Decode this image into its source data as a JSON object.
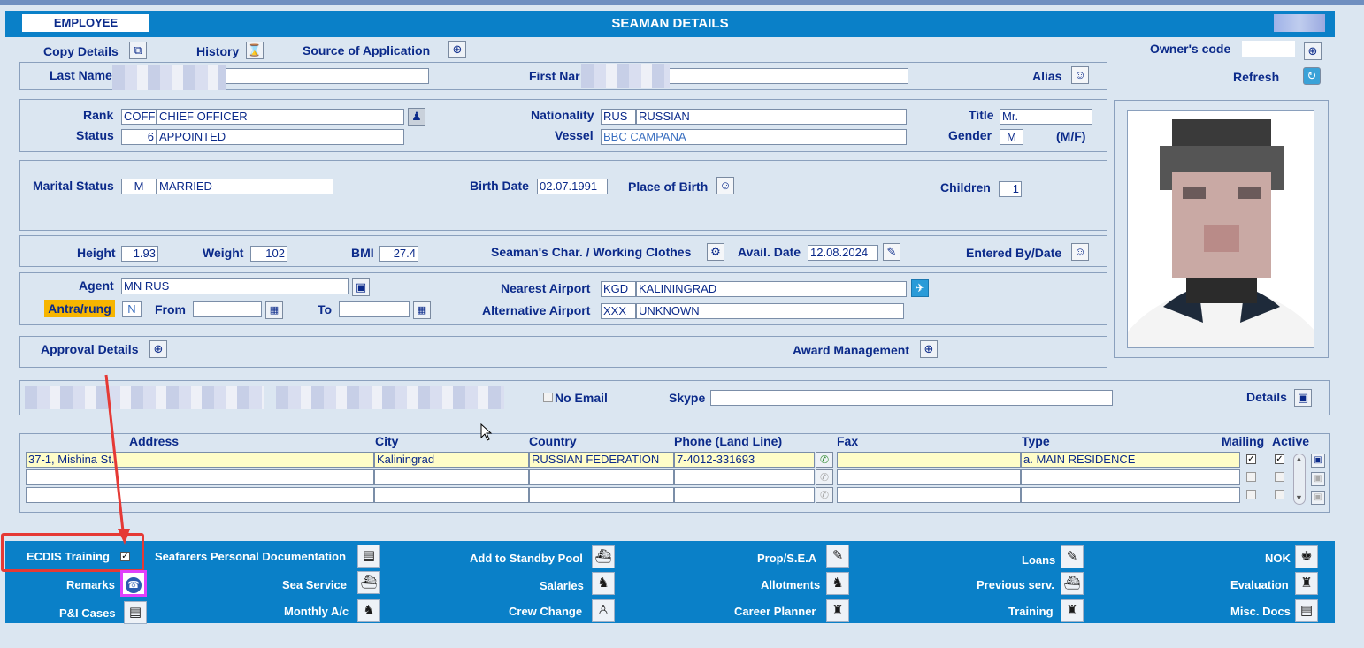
{
  "window": {
    "title": "SEAMAN DETAILS",
    "employee_tab": "EMPLOYEE"
  },
  "toolbar": {
    "copy_details": "Copy Details",
    "history": "History",
    "source_of_application": "Source of Application",
    "owners_code": "Owner's code",
    "owners_code_value": "",
    "refresh": "Refresh"
  },
  "names": {
    "last_name_label": "Last Name",
    "first_name_label": "First Nar",
    "alias_label": "Alias"
  },
  "rank_section": {
    "rank_label": "Rank",
    "rank_code": "COFF",
    "rank_name": "CHIEF OFFICER",
    "status_label": "Status",
    "status_code": "6",
    "status_name": "APPOINTED",
    "nationality_label": "Nationality",
    "nationality_code": "RUS",
    "nationality_name": "RUSSIAN",
    "vessel_label": "Vessel",
    "vessel_name": "BBC CAMPANA",
    "title_label": "Title",
    "title_value": "Mr.",
    "gender_label": "Gender",
    "gender_value": "M",
    "gender_hint": "(M/F)"
  },
  "personal": {
    "marital_label": "Marital Status",
    "marital_code": "M",
    "marital_name": "MARRIED",
    "birth_date_label": "Birth Date",
    "birth_date": "02.07.1991",
    "place_of_birth_label": "Place of Birth",
    "children_label": "Children",
    "children": "1"
  },
  "body": {
    "height_label": "Height",
    "height": "1.93",
    "weight_label": "Weight",
    "weight": "102",
    "bmi_label": "BMI",
    "bmi": "27.4",
    "char_label": "Seaman's Char. / Working Clothes",
    "avail_label": "Avail. Date",
    "avail_date": "12.08.2024",
    "entered_label": "Entered By/Date"
  },
  "agent": {
    "agent_label": "Agent",
    "agent_value": "MN RUS",
    "antra_label": "Antra/rung",
    "antra_value": "N",
    "from_label": "From",
    "to_label": "To",
    "nearest_label": "Nearest Airport",
    "nearest_code": "KGD",
    "nearest_name": "KALININGRAD",
    "alt_label": "Alternative Airport",
    "alt_code": "XXX",
    "alt_name": "UNKNOWN"
  },
  "approval": {
    "approval_label": "Approval Details",
    "award_label": "Award Management"
  },
  "contact": {
    "no_email_label": "No Email",
    "skype_label": "Skype",
    "details_label": "Details"
  },
  "address_table": {
    "headers": [
      "Address",
      "City",
      "Country",
      "Phone (Land Line)",
      "Fax",
      "Type",
      "Mailing",
      "Active"
    ],
    "rows": [
      {
        "address": "37-1, Mishina St.",
        "city": "Kaliningrad",
        "country": "RUSSIAN FEDERATION",
        "phone": "7-4012-331693",
        "fax": "",
        "type": "a. MAIN RESIDENCE",
        "mailing": "✓",
        "active": "✓"
      },
      {
        "address": "",
        "city": "",
        "country": "",
        "phone": "",
        "fax": "",
        "type": "",
        "mailing": "",
        "active": ""
      },
      {
        "address": "",
        "city": "",
        "country": "",
        "phone": "",
        "fax": "",
        "type": "",
        "mailing": "",
        "active": ""
      }
    ]
  },
  "bottom": {
    "ecdis": "ECDIS Training",
    "ecdis_checked": "✓",
    "remarks": "Remarks",
    "pi_cases": "P&I Cases",
    "personal_docs": "Seafarers Personal Documentation",
    "sea_service": "Sea Service",
    "monthly": "Monthly A/c",
    "standby": "Add to Standby Pool",
    "salaries": "Salaries",
    "crew_change": "Crew Change",
    "prop_sea": "Prop/S.E.A",
    "allotments": "Allotments",
    "career_planner": "Career Planner",
    "loans": "Loans",
    "previous_serv": "Previous serv.",
    "training": "Training",
    "nok": "NOK",
    "evaluation": "Evaluation",
    "misc_docs": "Misc. Docs"
  },
  "colors": {
    "accent_blue": "#0a80c8",
    "panel_bg": "#dbe6f1",
    "highlight_yellow": "#fffdc8",
    "antra_orange": "#f7b500",
    "annotation_red": "#e53935",
    "annotation_magenta": "#e040fb"
  }
}
